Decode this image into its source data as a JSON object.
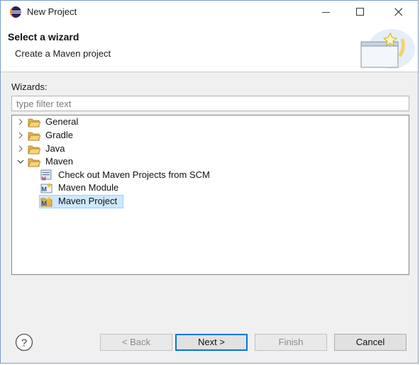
{
  "window": {
    "title": "New Project"
  },
  "banner": {
    "title": "Select a wizard",
    "description": "Create a Maven project"
  },
  "wizards": {
    "label": "Wizards:",
    "filter_placeholder": "type filter text"
  },
  "tree": {
    "items": [
      {
        "label": "General",
        "type": "folder",
        "expanded": false
      },
      {
        "label": "Gradle",
        "type": "folder",
        "expanded": false
      },
      {
        "label": "Java",
        "type": "folder",
        "expanded": false
      },
      {
        "label": "Maven",
        "type": "folder",
        "expanded": true
      },
      {
        "label": "Check out Maven Projects from SCM",
        "type": "maven-scm",
        "selected": false
      },
      {
        "label": "Maven Module",
        "type": "maven",
        "selected": false
      },
      {
        "label": "Maven Project",
        "type": "maven",
        "selected": true
      }
    ]
  },
  "buttons": {
    "back": "< Back",
    "next": "Next >",
    "finish": "Finish",
    "cancel": "Cancel"
  },
  "colors": {
    "selection": "#cce8ff",
    "default_button_border": "#0078d7"
  }
}
